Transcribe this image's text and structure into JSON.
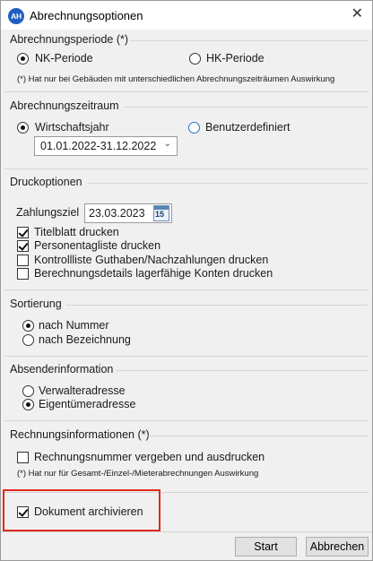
{
  "window": {
    "icon_text": "AH",
    "title": "Abrechnungsoptionen",
    "close_symbol": "✕"
  },
  "period": {
    "label": "Abrechnungsperiode (*)",
    "options": [
      "NK-Periode",
      "HK-Periode"
    ],
    "selected": "NK-Periode",
    "note": "(*) Hat nur bei Gebäuden mit unterschiedlichen Abrechnungszeiträumen Auswirkung"
  },
  "range": {
    "label": "Abrechnungszeitraum",
    "options": [
      "Wirtschaftsjahr",
      "Benutzerdefiniert"
    ],
    "selected": "Wirtschaftsjahr",
    "select_value": "01.01.2022-31.12.2022"
  },
  "print": {
    "label": "Druckoptionen",
    "due_label": "Zahlungsziel",
    "due_value": "23.03.2023",
    "calendar_num": "15",
    "checks": [
      {
        "label": "Titelblatt drucken",
        "checked": true
      },
      {
        "label": "Personentagliste drucken",
        "checked": true
      },
      {
        "label": "Kontrollliste Guthaben/Nachzahlungen drucken",
        "checked": false
      },
      {
        "label": "Berechnungsdetails lagerfähige Konten drucken",
        "checked": false
      }
    ]
  },
  "sort": {
    "label": "Sortierung",
    "options": [
      "nach Nummer",
      "nach Bezeichnung"
    ],
    "selected": "nach Nummer"
  },
  "sender": {
    "label": "Absenderinformation",
    "options": [
      "Verwalteradresse",
      "Eigentümeradresse"
    ],
    "selected": "Eigentümeradresse"
  },
  "invoice": {
    "label": "Rechnungsinformationen (*)",
    "check_label": "Rechnungsnummer vergeben und ausdrucken",
    "checked": false,
    "note": "(*) Hat nur für Gesamt-/Einzel-/Mieterabrechnungen Auswirkung"
  },
  "archive": {
    "label": "Dokument archivieren",
    "checked": true
  },
  "buttons": {
    "start": "Start",
    "cancel": "Abbrechen"
  },
  "colors": {
    "highlight": "#e0281f",
    "accent_blue": "#2a6fd6"
  }
}
